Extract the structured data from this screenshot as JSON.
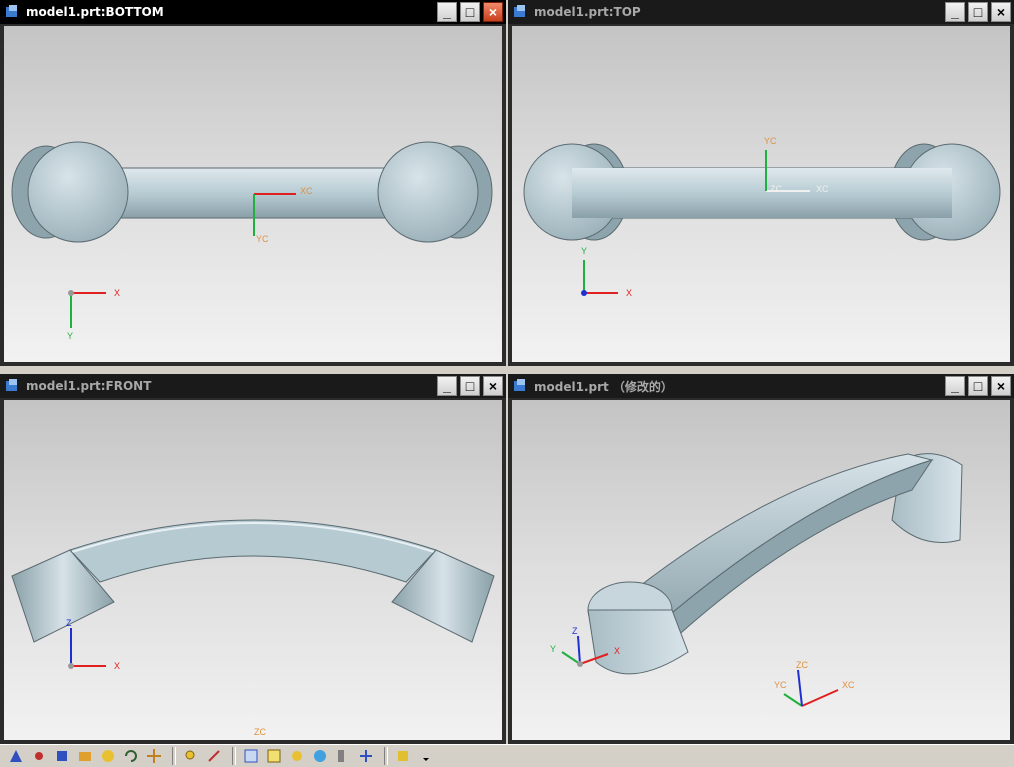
{
  "viewports": [
    {
      "id": "bottom",
      "title": "model1.prt:BOTTOM",
      "active": true,
      "wcs": {
        "x": "XC",
        "y": "YC"
      },
      "triad": {
        "x": "X",
        "y": "Y"
      }
    },
    {
      "id": "top",
      "title": "model1.prt:TOP",
      "active": false,
      "wcs": {
        "x": "XC",
        "y": "YC",
        "z": "ZC"
      },
      "triad": {
        "x": "X",
        "y": "Y"
      }
    },
    {
      "id": "front",
      "title": "model1.prt:FRONT",
      "active": false,
      "wcs": {
        "z": "ZC"
      },
      "triad": {
        "x": "X",
        "z": "Z"
      }
    },
    {
      "id": "iso",
      "title": "model1.prt （修改的）",
      "active": false,
      "wcs": {
        "x": "XC",
        "y": "YC",
        "z": "ZC"
      },
      "triad": {
        "x": "X",
        "y": "Y",
        "z": "Z"
      }
    }
  ],
  "window_buttons": {
    "minimize": "_",
    "maximize": "□",
    "close": "×"
  },
  "colors": {
    "titlebar": "#000000",
    "model": "#b4c8d0",
    "axis_x": "#e02020",
    "axis_y": "#20b040",
    "axis_z": "#2030d0",
    "wcs_label": "#e09040"
  },
  "toolbar": {
    "icons": [
      "snap-icon",
      "point-icon",
      "filter-icon",
      "view-orient-icon",
      "render-icon",
      "rotate-icon",
      "pan-icon",
      "zoom-icon",
      "layer-icon",
      "wcs-icon",
      "shade-icon",
      "face-icon",
      "edge-icon",
      "measure-icon",
      "analysis-icon",
      "tree-icon",
      "more-icon"
    ]
  }
}
